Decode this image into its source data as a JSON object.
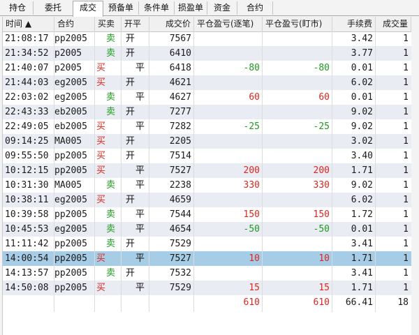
{
  "tabs": [
    {
      "label": "持仓"
    },
    {
      "label": "委托"
    },
    {
      "label": "成交",
      "active": true
    },
    {
      "label": "预备单"
    },
    {
      "label": "条件单"
    },
    {
      "label": "损盈单"
    },
    {
      "label": "资金"
    },
    {
      "label": "合约"
    }
  ],
  "columns": {
    "time": "时间 ▲",
    "contract": "合约",
    "side": "买卖",
    "openclose": "开平",
    "price": "成交价",
    "pnl_trade": "平仓盈亏(逐笔)",
    "pnl_mtm": "平仓盈亏(盯市)",
    "fee": "手续费",
    "qty": "成交量"
  },
  "trades": [
    {
      "time": "21:08:17",
      "contract": "pp2005",
      "side": "卖",
      "openclose": "开",
      "price": "7567",
      "pnl_trade": "",
      "pnl_mtm": "",
      "fee": "3.42",
      "qty": "1"
    },
    {
      "time": "21:34:52",
      "contract": "p2005",
      "side": "卖",
      "openclose": "开",
      "price": "6410",
      "pnl_trade": "",
      "pnl_mtm": "",
      "fee": "3.77",
      "qty": "1"
    },
    {
      "time": "21:40:07",
      "contract": "p2005",
      "side": "买",
      "openclose": "平",
      "price": "6418",
      "pnl_trade": "-80",
      "pnl_mtm": "-80",
      "fee": "0.01",
      "qty": "1"
    },
    {
      "time": "21:44:03",
      "contract": "eg2005",
      "side": "买",
      "openclose": "开",
      "price": "4621",
      "pnl_trade": "",
      "pnl_mtm": "",
      "fee": "6.02",
      "qty": "1"
    },
    {
      "time": "22:03:02",
      "contract": "eg2005",
      "side": "卖",
      "openclose": "平",
      "price": "4627",
      "pnl_trade": "60",
      "pnl_mtm": "60",
      "fee": "0.01",
      "qty": "1"
    },
    {
      "time": "22:43:33",
      "contract": "eb2005",
      "side": "卖",
      "openclose": "开",
      "price": "7277",
      "pnl_trade": "",
      "pnl_mtm": "",
      "fee": "9.02",
      "qty": "1"
    },
    {
      "time": "22:49:05",
      "contract": "eb2005",
      "side": "买",
      "openclose": "平",
      "price": "7282",
      "pnl_trade": "-25",
      "pnl_mtm": "-25",
      "fee": "9.02",
      "qty": "1"
    },
    {
      "time": "09:14:25",
      "contract": "MA005",
      "side": "买",
      "openclose": "开",
      "price": "2205",
      "pnl_trade": "",
      "pnl_mtm": "",
      "fee": "3.02",
      "qty": "1"
    },
    {
      "time": "09:55:50",
      "contract": "pp2005",
      "side": "买",
      "openclose": "开",
      "price": "7514",
      "pnl_trade": "",
      "pnl_mtm": "",
      "fee": "3.40",
      "qty": "1"
    },
    {
      "time": "10:12:15",
      "contract": "pp2005",
      "side": "买",
      "openclose": "平",
      "price": "7527",
      "pnl_trade": "200",
      "pnl_mtm": "200",
      "fee": "1.71",
      "qty": "1"
    },
    {
      "time": "10:31:30",
      "contract": "MA005",
      "side": "卖",
      "openclose": "平",
      "price": "2238",
      "pnl_trade": "330",
      "pnl_mtm": "330",
      "fee": "9.02",
      "qty": "1"
    },
    {
      "time": "10:38:11",
      "contract": "eg2005",
      "side": "买",
      "openclose": "开",
      "price": "4659",
      "pnl_trade": "",
      "pnl_mtm": "",
      "fee": "6.02",
      "qty": "1"
    },
    {
      "time": "10:39:58",
      "contract": "pp2005",
      "side": "卖",
      "openclose": "平",
      "price": "7544",
      "pnl_trade": "150",
      "pnl_mtm": "150",
      "fee": "1.72",
      "qty": "1"
    },
    {
      "time": "10:45:53",
      "contract": "eg2005",
      "side": "卖",
      "openclose": "平",
      "price": "4654",
      "pnl_trade": "-50",
      "pnl_mtm": "-50",
      "fee": "0.01",
      "qty": "1"
    },
    {
      "time": "11:11:42",
      "contract": "pp2005",
      "side": "卖",
      "openclose": "开",
      "price": "7529",
      "pnl_trade": "",
      "pnl_mtm": "",
      "fee": "3.41",
      "qty": "1"
    },
    {
      "time": "14:00:54",
      "contract": "pp2005",
      "side": "买",
      "openclose": "平",
      "price": "7527",
      "pnl_trade": "10",
      "pnl_mtm": "10",
      "fee": "1.71",
      "qty": "1",
      "selected": true
    },
    {
      "time": "14:13:57",
      "contract": "pp2005",
      "side": "卖",
      "openclose": "开",
      "price": "7532",
      "pnl_trade": "",
      "pnl_mtm": "",
      "fee": "3.41",
      "qty": "1"
    },
    {
      "time": "14:50:08",
      "contract": "pp2005",
      "side": "买",
      "openclose": "平",
      "price": "7529",
      "pnl_trade": "15",
      "pnl_mtm": "15",
      "fee": "1.71",
      "qty": "1"
    }
  ],
  "totals": {
    "pnl_trade": "610",
    "pnl_mtm": "610",
    "fee": "66.41",
    "qty": "18"
  },
  "colors": {
    "buy": "#e0251d",
    "sell": "#1e9a1e",
    "selected_row": "#a7cde6",
    "alt_row": "#e9ecf3"
  }
}
